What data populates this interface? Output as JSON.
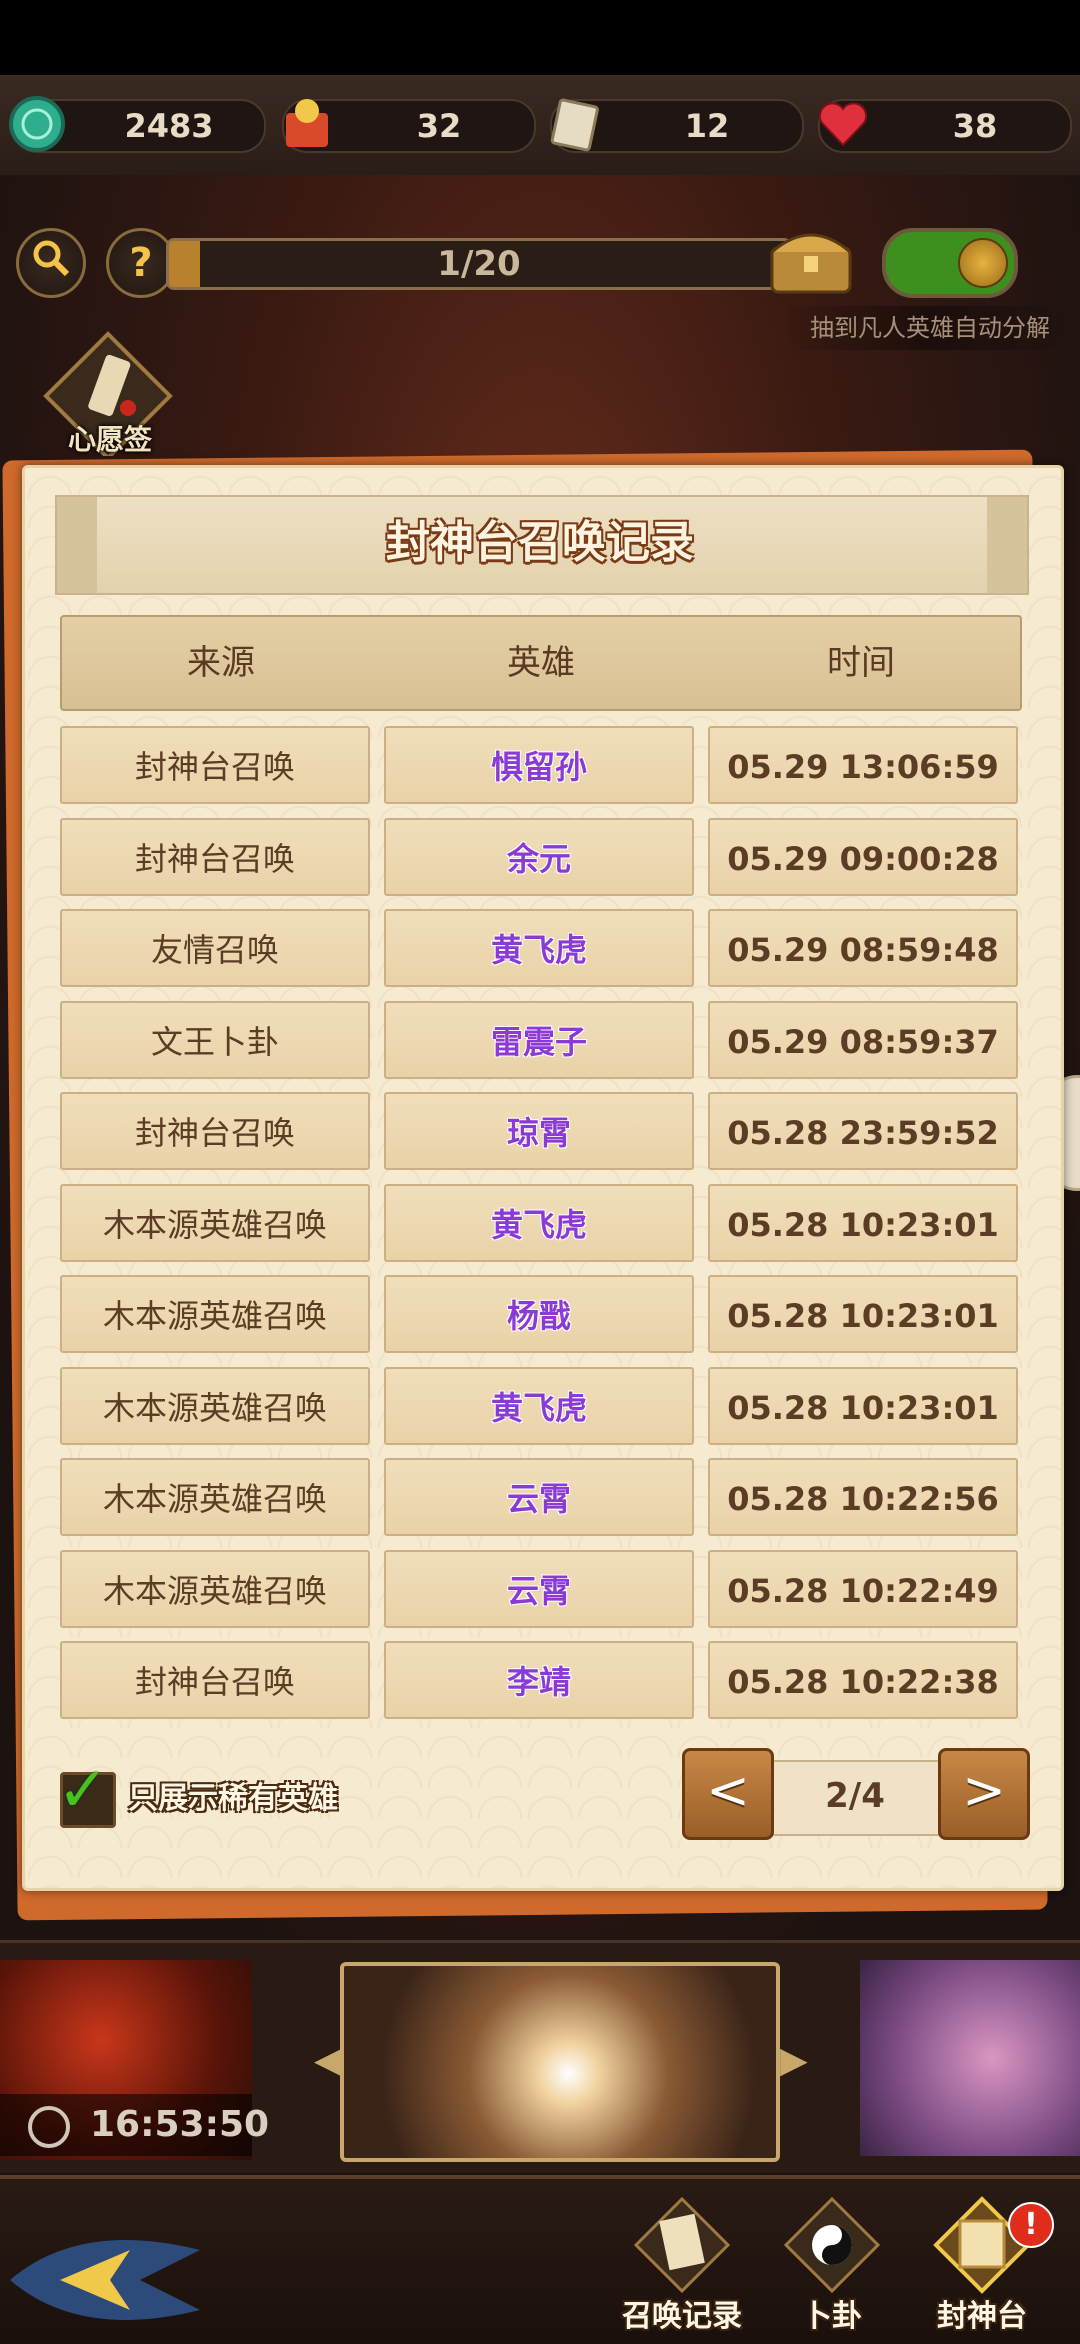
{
  "resources": [
    {
      "icon": "jade-coin-icon",
      "value": "2483"
    },
    {
      "icon": "summon-gift-icon",
      "value": "32"
    },
    {
      "icon": "ticket-icon",
      "value": "12"
    },
    {
      "icon": "heart-icon",
      "value": "38"
    }
  ],
  "progress": {
    "text": "1/20",
    "fraction": 0.05
  },
  "auto_decompose_text": "抽到凡人英雄自动分解",
  "wish_label": "心愿签",
  "dialog": {
    "title": "封神台召唤记录",
    "headers": [
      "来源",
      "英雄",
      "时间"
    ],
    "rows": [
      {
        "source": "封神台召唤",
        "hero": "惧留孙",
        "time": "05.29 13:06:59"
      },
      {
        "source": "封神台召唤",
        "hero": "余元",
        "time": "05.29 09:00:28"
      },
      {
        "source": "友情召唤",
        "hero": "黄飞虎",
        "time": "05.29 08:59:48"
      },
      {
        "source": "文王卜卦",
        "hero": "雷震子",
        "time": "05.29 08:59:37"
      },
      {
        "source": "封神台召唤",
        "hero": "琼霄",
        "time": "05.28 23:59:52"
      },
      {
        "source": "木本源英雄召唤",
        "hero": "黄飞虎",
        "time": "05.28 10:23:01"
      },
      {
        "source": "木本源英雄召唤",
        "hero": "杨戬",
        "time": "05.28 10:23:01"
      },
      {
        "source": "木本源英雄召唤",
        "hero": "黄飞虎",
        "time": "05.28 10:23:01"
      },
      {
        "source": "木本源英雄召唤",
        "hero": "云霄",
        "time": "05.28 10:22:56"
      },
      {
        "source": "木本源英雄召唤",
        "hero": "云霄",
        "time": "05.28 10:22:49"
      },
      {
        "source": "封神台召唤",
        "hero": "李靖",
        "time": "05.28 10:22:38"
      }
    ],
    "filter_label": "只展示稀有英雄",
    "filter_checked": true,
    "page": "2/4",
    "prev_symbol": "<",
    "next_symbol": ">"
  },
  "timer": "16:53:50",
  "nav": [
    {
      "label": "召唤记录",
      "icon": "scroll-record-icon"
    },
    {
      "label": "卜卦",
      "icon": "bagua-icon"
    },
    {
      "label": "封神台",
      "icon": "altar-scroll-icon"
    }
  ],
  "notification_badge": "!",
  "colors": {
    "hero_text": "#8c3ad6",
    "accent": "#cf6a2c",
    "toggle_on": "#3f8f1f"
  }
}
